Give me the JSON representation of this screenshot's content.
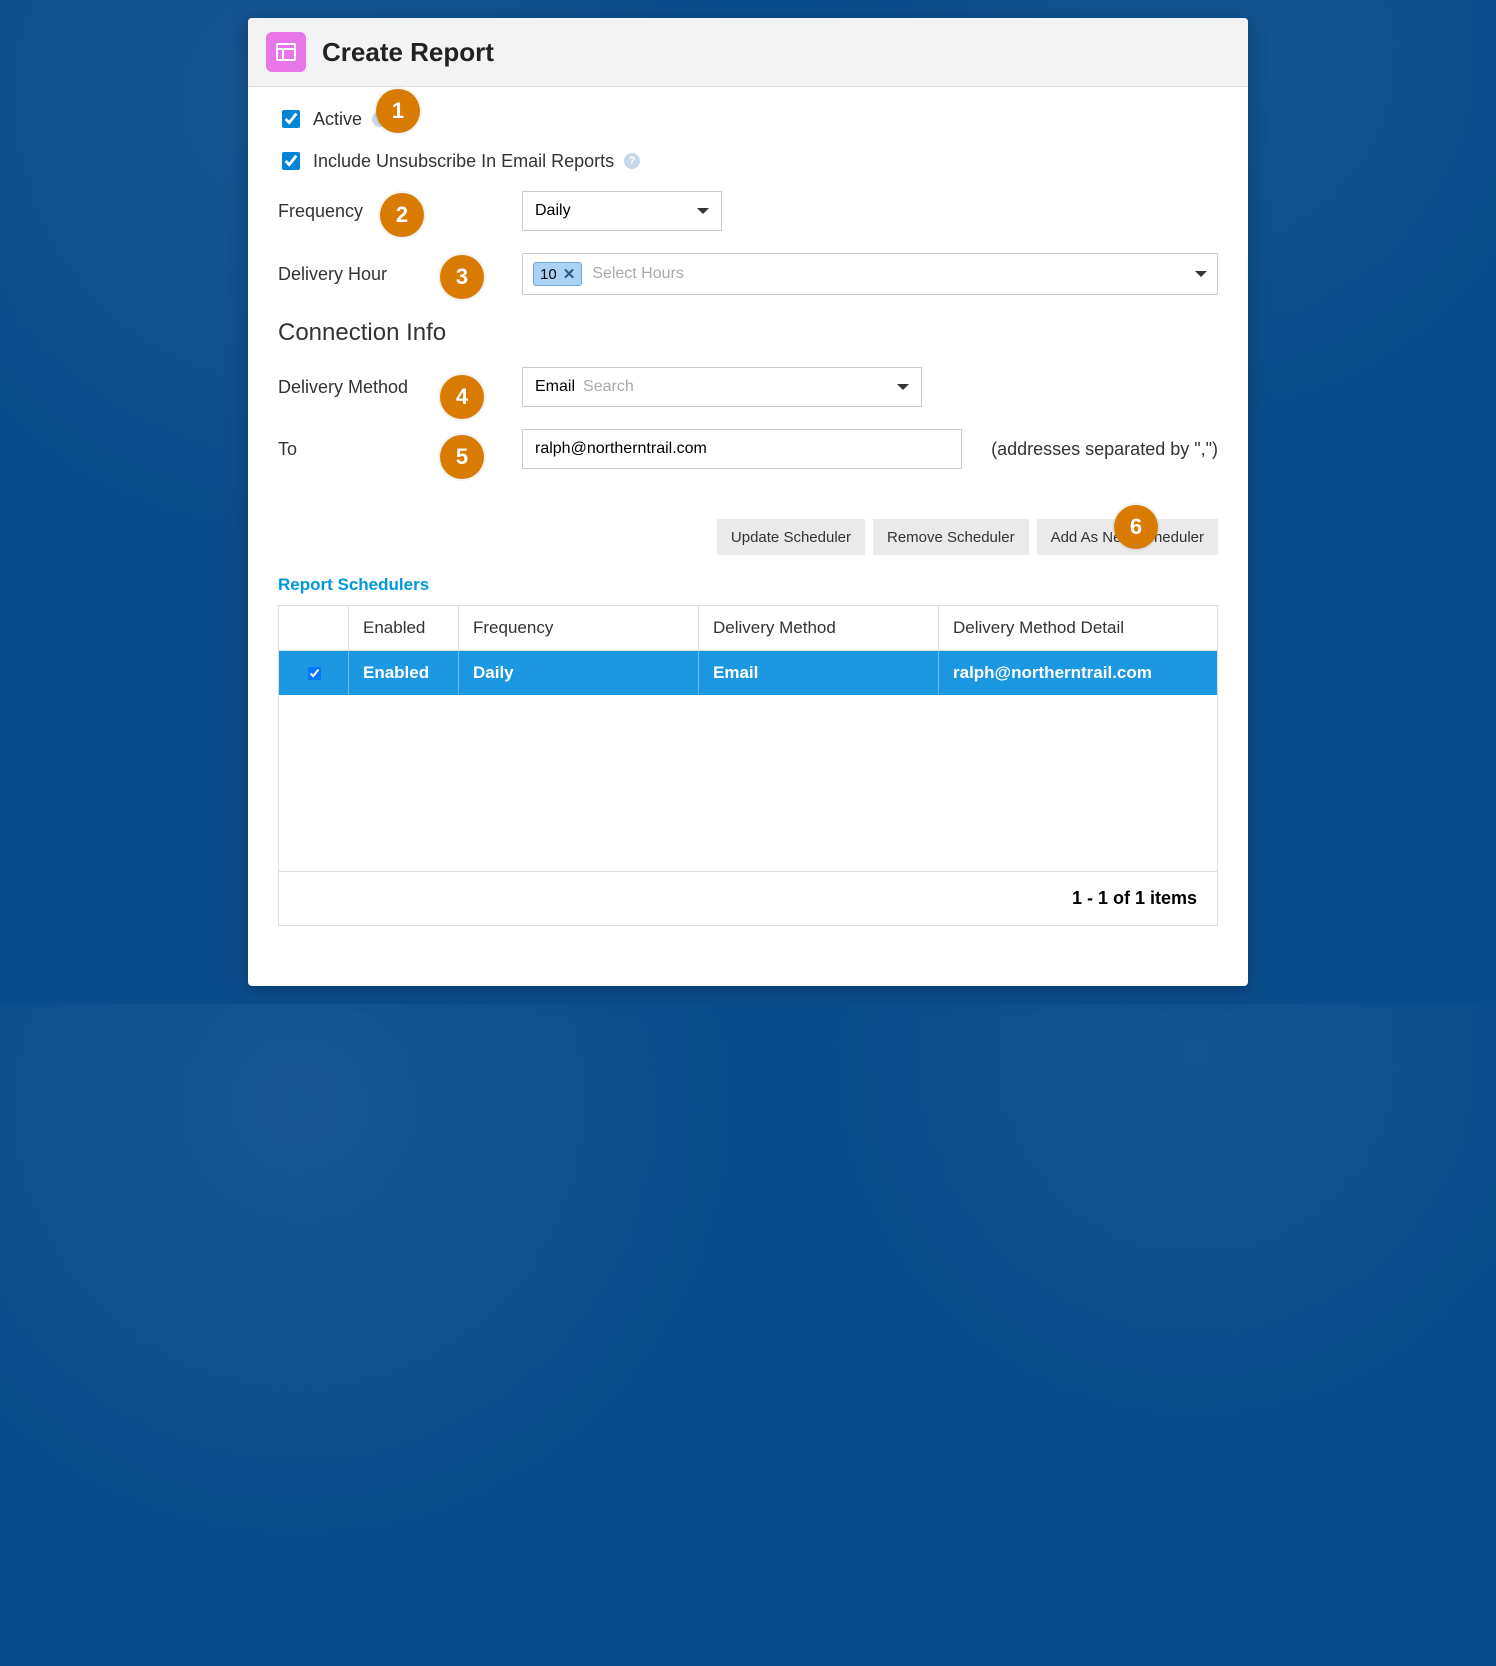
{
  "header": {
    "title": "Create Report"
  },
  "checks": {
    "active_label": "Active",
    "active_checked": true,
    "unsub_label": "Include Unsubscribe In Email Reports",
    "unsub_checked": true
  },
  "frequency": {
    "label": "Frequency",
    "value": "Daily"
  },
  "delivery_hour": {
    "label": "Delivery Hour",
    "chips": [
      "10"
    ],
    "placeholder": "Select Hours"
  },
  "section_connection": "Connection Info",
  "delivery_method": {
    "label": "Delivery Method",
    "value": "Email",
    "search_placeholder": "Search"
  },
  "to": {
    "label": "To",
    "value": "ralph@northerntrail.com",
    "hint": "(addresses separated by \",\")"
  },
  "buttons": {
    "update": "Update Scheduler",
    "remove": "Remove Scheduler",
    "add": "Add As New Scheduler"
  },
  "schedulers": {
    "title": "Report Schedulers",
    "headers": {
      "enabled": "Enabled",
      "frequency": "Frequency",
      "method": "Delivery Method",
      "detail": "Delivery Method Detail"
    },
    "rows": [
      {
        "checked": true,
        "enabled": "Enabled",
        "frequency": "Daily",
        "method": "Email",
        "detail": "ralph@northerntrail.com"
      }
    ],
    "footer": "1 - 1 of 1 items"
  },
  "callouts": [
    "1",
    "2",
    "3",
    "4",
    "5",
    "6"
  ]
}
